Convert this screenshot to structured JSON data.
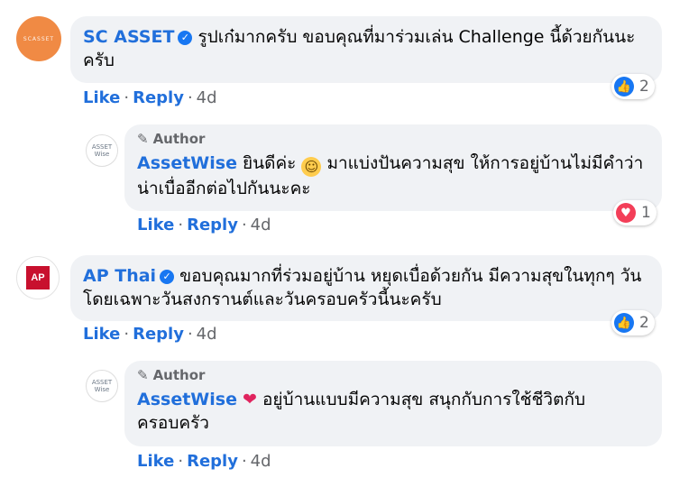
{
  "comments": [
    {
      "author": "SC ASSET",
      "text": "รูปเก๋มากครับ ขอบคุณที่มาร่วมเล่น Challenge นี้ด้วยกันนะครับ",
      "like_label": "Like",
      "reply_label": "Reply",
      "time": "4d",
      "reaction_count": "2",
      "avatar_text": "SCASSET",
      "reply": {
        "author": "AssetWise",
        "author_badge": "Author",
        "text_before": "ยินดีค่ะ",
        "text_after": "มาแบ่งปันความสุข ให้การอยู่บ้านไม่มีคำว่าน่าเบื่ออีกต่อไปกันนะคะ",
        "like_label": "Like",
        "reply_label": "Reply",
        "time": "4d",
        "reaction_count": "1",
        "avatar_line1": "ASSET",
        "avatar_line2": "Wise"
      }
    },
    {
      "author": "AP Thai",
      "text": "ขอบคุณมากที่ร่วมอยู่บ้าน หยุดเบื่อด้วยกัน มีความสุขในทุกๆ วัน โดยเฉพาะวันสงกรานต์และวันครอบครัวนี้นะครับ",
      "like_label": "Like",
      "reply_label": "Reply",
      "time": "4d",
      "reaction_count": "2",
      "avatar_text": "AP",
      "reply": {
        "author": "AssetWise",
        "author_badge": "Author",
        "text": "อยู่บ้านแบบมีความสุข สนุกกับการใช้ชีวิตกับครอบครัว",
        "like_label": "Like",
        "reply_label": "Reply",
        "time": "4d",
        "avatar_line1": "ASSET",
        "avatar_line2": "Wise"
      }
    }
  ],
  "icons": {
    "verified": "verified-badge-icon",
    "author_pen": "pen-icon",
    "like_reaction": "like-reaction-icon",
    "love_reaction": "love-reaction-icon",
    "grin_emoji": "grinning-emoji",
    "heart_emoji": "red-heart-emoji"
  },
  "colors": {
    "link": "#216fdb",
    "bubble": "#f0f2f5",
    "like": "#1877f2",
    "love": "#f33e58",
    "muted": "#65676b"
  }
}
